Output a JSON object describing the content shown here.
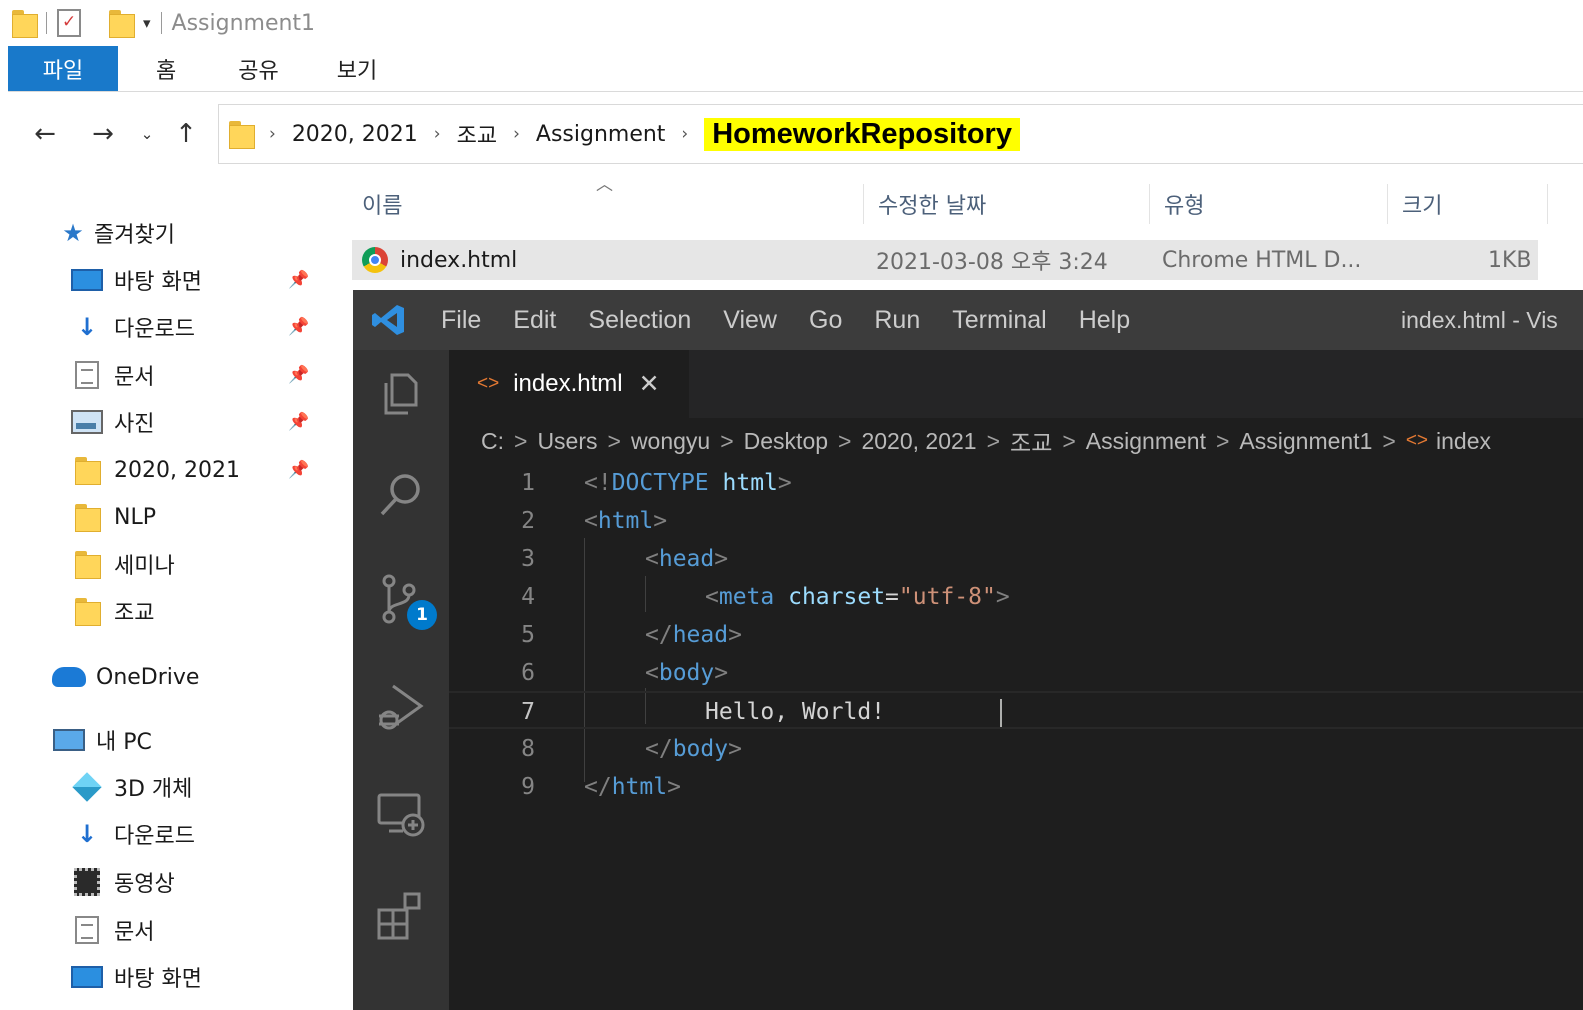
{
  "explorer": {
    "title": "Assignment1",
    "ribbon_tabs": [
      "파일",
      "홈",
      "공유",
      "보기"
    ],
    "breadcrumb": [
      "2020, 2021",
      "조교",
      "Assignment",
      "HomeworkRepository"
    ],
    "columns": {
      "name": "이름",
      "modified": "수정한 날짜",
      "type": "유형",
      "size": "크기"
    },
    "files": [
      {
        "name": "index.html",
        "modified": "2021-03-08 오후 3:24",
        "type": "Chrome HTML D...",
        "size": "1KB"
      }
    ],
    "nav": {
      "quick_access": "즐겨찾기",
      "pinned": [
        "바탕 화면",
        "다운로드",
        "문서",
        "사진",
        "2020, 2021"
      ],
      "folders": [
        "NLP",
        "세미나",
        "조교"
      ],
      "onedrive": "OneDrive",
      "this_pc": "내 PC",
      "pc_items": [
        "3D 개체",
        "다운로드",
        "동영상",
        "문서",
        "바탕 화면"
      ]
    },
    "highlight_color": "#ffff00"
  },
  "vscode": {
    "menu": [
      "File",
      "Edit",
      "Selection",
      "View",
      "Go",
      "Run",
      "Terminal",
      "Help"
    ],
    "window_title": "index.html - Vis",
    "tab": {
      "name": "index.html",
      "close": "✕"
    },
    "breadcrumb": [
      "C:",
      "Users",
      "wongyu",
      "Desktop",
      "2020, 2021",
      "조교",
      "Assignment",
      "Assignment1",
      "index"
    ],
    "scm_badge": "1",
    "line_numbers": [
      "1",
      "2",
      "3",
      "4",
      "5",
      "6",
      "7",
      "8",
      "9"
    ],
    "code": {
      "l1": {
        "open": "<!",
        "doctype": "DOCTYPE",
        "tag": "html",
        "close": ">"
      },
      "l2": {
        "open": "<",
        "tag": "html",
        "close": ">"
      },
      "l3": {
        "open": "<",
        "tag": "head",
        "close": ">"
      },
      "l4": {
        "open": "<",
        "tag": "meta",
        "attr": "charset",
        "eq": "=",
        "value": "\"utf-8\"",
        "close": ">"
      },
      "l5": {
        "open": "</",
        "tag": "head",
        "close": ">"
      },
      "l6": {
        "open": "<",
        "tag": "body",
        "close": ">"
      },
      "l7": {
        "text": "Hello, World!"
      },
      "l8": {
        "open": "</",
        "tag": "body",
        "close": ">"
      },
      "l9": {
        "open": "</",
        "tag": "html",
        "close": ">"
      }
    },
    "current_line": "7"
  }
}
